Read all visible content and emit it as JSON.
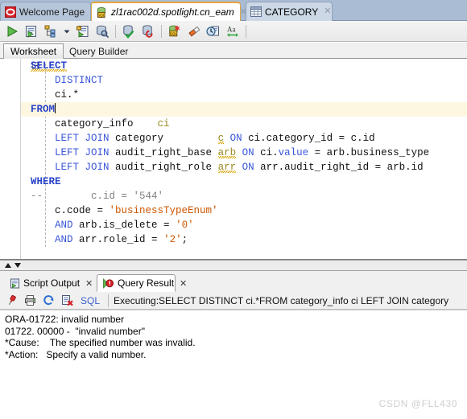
{
  "window": {
    "tabs": [
      {
        "label": "Welcome Page",
        "icon": "oracle-logo-icon",
        "active": false,
        "closeable": true,
        "italic": false
      },
      {
        "label": "zl1rac002d.spotlight.cn_eam",
        "icon": "sql-worksheet-icon",
        "active": true,
        "closeable": true,
        "italic": true
      },
      {
        "label": "CATEGORY",
        "icon": "table-grid-icon",
        "active": false,
        "closeable": true,
        "italic": false
      }
    ]
  },
  "toolbar": {
    "buttons": [
      {
        "name": "run-statement-icon",
        "tooltip": "Run Statement"
      },
      {
        "name": "run-script-icon",
        "tooltip": "Run Script"
      },
      {
        "name": "explain-plan-icon",
        "tooltip": "Explain Plan"
      },
      {
        "name": "dropdown-arrow-icon",
        "tooltip": "More"
      },
      {
        "name": "autotrace-icon",
        "tooltip": "Autotrace"
      },
      {
        "name": "sql-tuning-advisor-icon",
        "tooltip": "SQL Tuning Advisor"
      },
      {
        "name": "commit-icon",
        "tooltip": "Commit"
      },
      {
        "name": "rollback-icon",
        "tooltip": "Rollback"
      },
      {
        "name": "unshared-sql-worksheet-icon",
        "tooltip": "Unshared SQL Worksheet"
      },
      {
        "name": "clear-worksheet-icon",
        "tooltip": "Clear"
      },
      {
        "name": "sql-history-icon",
        "tooltip": "SQL History"
      },
      {
        "name": "format-sql-icon",
        "tooltip": "Format SQL"
      }
    ]
  },
  "subtabs": [
    {
      "label": "Worksheet",
      "selected": true
    },
    {
      "label": "Query Builder",
      "selected": false
    }
  ],
  "editor": {
    "current_line_index": 3,
    "lines": [
      [
        {
          "t": "SELECT",
          "c": "kw sq"
        }
      ],
      [
        {
          "t": "    DISTINCT",
          "c": "kw2"
        }
      ],
      [
        {
          "t": "    ci.*",
          "c": "pln"
        }
      ],
      [
        {
          "t": "FROM",
          "c": "kw"
        },
        {
          "t": "CARET",
          "c": "caret"
        }
      ],
      [
        {
          "t": "    category_info    ",
          "c": "pln"
        },
        {
          "t": "ci",
          "c": "alias"
        }
      ],
      [
        {
          "t": "    ",
          "c": "pln"
        },
        {
          "t": "LEFT JOIN",
          "c": "kw2"
        },
        {
          "t": " category         ",
          "c": "pln"
        },
        {
          "t": "c",
          "c": "alias sq"
        },
        {
          "t": " ",
          "c": "pln"
        },
        {
          "t": "ON",
          "c": "kw2"
        },
        {
          "t": " ci.category_id = c.id",
          "c": "pln"
        }
      ],
      [
        {
          "t": "    ",
          "c": "pln"
        },
        {
          "t": "LEFT JOIN",
          "c": "kw2"
        },
        {
          "t": " audit_right_base ",
          "c": "pln"
        },
        {
          "t": "arb",
          "c": "alias sq"
        },
        {
          "t": " ",
          "c": "pln"
        },
        {
          "t": "ON",
          "c": "kw2"
        },
        {
          "t": " ci.",
          "c": "pln"
        },
        {
          "t": "value",
          "c": "kw2"
        },
        {
          "t": " = arb.business_type",
          "c": "pln"
        }
      ],
      [
        {
          "t": "    ",
          "c": "pln"
        },
        {
          "t": "LEFT JOIN",
          "c": "kw2"
        },
        {
          "t": " audit_right_role ",
          "c": "pln"
        },
        {
          "t": "arr",
          "c": "alias sq"
        },
        {
          "t": " ",
          "c": "pln"
        },
        {
          "t": "ON",
          "c": "kw2"
        },
        {
          "t": " arr.audit_right_id = arb.id",
          "c": "pln"
        }
      ],
      [
        {
          "t": "WHERE",
          "c": "kw"
        }
      ],
      [
        {
          "t": "--        c.id = '544'",
          "c": "cmt"
        }
      ],
      [
        {
          "t": "    c.code = ",
          "c": "pln"
        },
        {
          "t": "'businessTypeEnum'",
          "c": "str"
        }
      ],
      [
        {
          "t": "    ",
          "c": "pln"
        },
        {
          "t": "AND",
          "c": "kw2"
        },
        {
          "t": " arb.is_delete = ",
          "c": "pln"
        },
        {
          "t": "'0'",
          "c": "str"
        }
      ],
      [
        {
          "t": "    ",
          "c": "pln"
        },
        {
          "t": "AND",
          "c": "kw2"
        },
        {
          "t": " arr.role_id = ",
          "c": "pln"
        },
        {
          "t": "'2'",
          "c": "str"
        },
        {
          "t": ";",
          "c": "pln"
        }
      ]
    ]
  },
  "output": {
    "tabs": [
      {
        "label": "Script Output",
        "icon": "script-output-icon",
        "selected": false,
        "closeable": true
      },
      {
        "label": "Query Result",
        "icon": "query-result-error-icon",
        "selected": true,
        "closeable": true
      }
    ],
    "toolbar": {
      "buttons": [
        {
          "name": "pin-icon",
          "tooltip": "Pin"
        },
        {
          "name": "print-icon",
          "tooltip": "Print"
        },
        {
          "name": "refresh-icon",
          "tooltip": "Refresh"
        },
        {
          "name": "clear-results-icon",
          "tooltip": "Clear"
        }
      ],
      "sql_label": "SQL",
      "executing_text": "Executing:SELECT    DISTINCT    ci.*FROM    category_info    ci    LEFT JOIN category"
    },
    "error": {
      "line1": "ORA-01722: invalid number",
      "line2": "01722. 00000 -  \"invalid number\"",
      "line3": "*Cause:    The specified number was invalid.",
      "line4": "*Action:   Specify a valid number."
    }
  },
  "watermark": "CSDN @FLL430",
  "colors": {
    "tabbar_bg": "#a9bcd4",
    "active_tab_border": "#e8a33d",
    "keyword": "#2a44c8",
    "string": "#cc5500",
    "alias": "#9a8a22",
    "comment": "#808080",
    "current_line": "#fdf6e0",
    "sql_link": "#3a5fcd",
    "watermark": "#cfcfcf"
  }
}
